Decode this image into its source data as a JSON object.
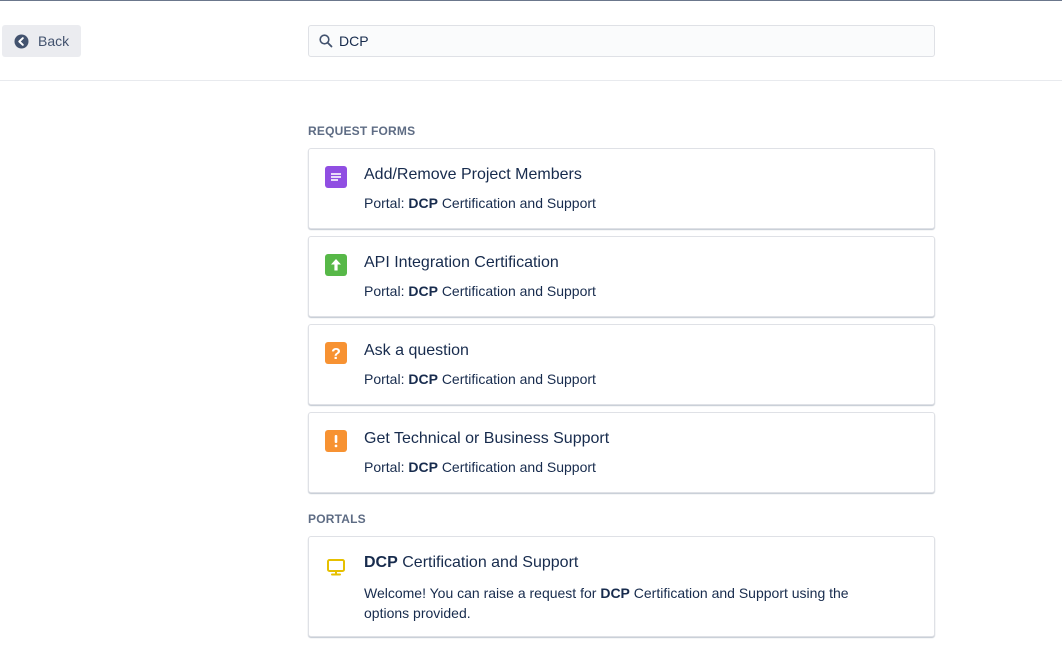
{
  "header": {
    "back_label": "Back",
    "search_value": "DCP"
  },
  "sections": {
    "request_forms_heading": "REQUEST FORMS",
    "portals_heading": "PORTALS"
  },
  "request_forms": [
    {
      "title": "Add/Remove Project Members",
      "portal_prefix": "Portal:",
      "portal_highlight": "DCP",
      "portal_rest": "Certification and Support",
      "icon": "document-icon",
      "icon_color": "#904ee2"
    },
    {
      "title": "API Integration Certification",
      "portal_prefix": "Portal:",
      "portal_highlight": "DCP",
      "portal_rest": "Certification and Support",
      "icon": "upload-arrow-icon",
      "icon_color": "#57b848"
    },
    {
      "title": "Ask a question",
      "portal_prefix": "Portal:",
      "portal_highlight": "DCP",
      "portal_rest": "Certification and Support",
      "icon": "question-icon",
      "icon_color": "#f79232"
    },
    {
      "title": "Get Technical or Business Support",
      "portal_prefix": "Portal:",
      "portal_highlight": "DCP",
      "portal_rest": "Certification and Support",
      "icon": "exclamation-icon",
      "icon_color": "#f79232"
    }
  ],
  "portal": {
    "title_highlight": "DCP",
    "title_rest": "Certification and Support",
    "desc_1": "Welcome! You can raise a request for",
    "desc_highlight": "DCP",
    "desc_2": "Certification and Support using the options provided.",
    "icon": "monitor-icon",
    "icon_color": "#e6c000"
  },
  "colors": {
    "text": "#172b4d",
    "muted": "#5e6c84",
    "border": "#dfe1e6"
  }
}
